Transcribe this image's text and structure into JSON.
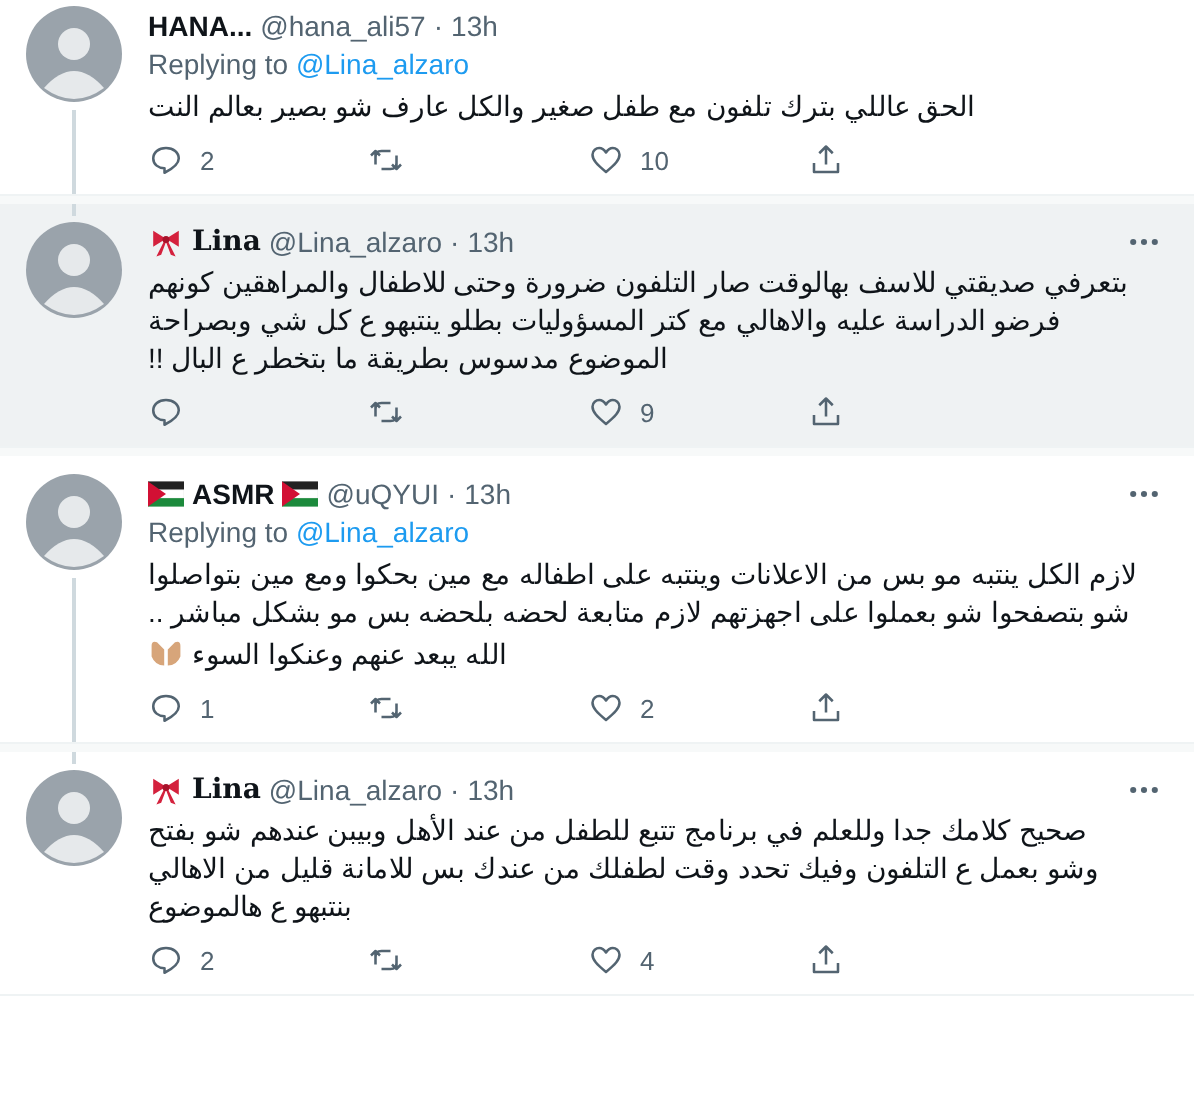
{
  "tweets": [
    {
      "name": "HANA...",
      "handle": "@hana_ali57",
      "separator": "·",
      "time": "13h",
      "show_more": false,
      "highlighted": false,
      "line_above": false,
      "line_below": true,
      "replying_label": "Replying to",
      "replying_to": "@Lina_alzaro",
      "paragraphs": [
        {
          "text": "الحق عاللي بترك تلفون مع طفل صغير والكل عارف شو بصير بعالم النت"
        }
      ],
      "replies": "2",
      "likes": "10"
    },
    {
      "name": "Lina",
      "name_serif": true,
      "ribbon_badge": true,
      "handle": "@Lina_alzaro",
      "separator": "·",
      "time": "13h",
      "show_more": true,
      "highlighted": true,
      "line_above": true,
      "line_below": false,
      "paragraphs": [
        {
          "text": "بتعرفي صديقتي للاسف بهالوقت صار التلفون ضرورة وحتى للاطفال والمراهقين كونهم فرضو الدراسة عليه والاهالي مع كتر المسؤوليات بطلو ينتبهو ع كل شي وبصراحة الموضوع مدسوس بطريقة ما بتخطر ع البال !!"
        }
      ],
      "likes": "9"
    },
    {
      "name": "ASMR",
      "flag_badges": true,
      "handle": "@uQYUI",
      "separator": "·",
      "time": "13h",
      "show_more": true,
      "highlighted": false,
      "line_above": false,
      "line_below": true,
      "replying_label": "Replying to",
      "replying_to": "@Lina_alzaro",
      "paragraphs": [
        {
          "text": "لازم الكل ينتبه مو بس من الاعلانات وينتبه على اطفاله مع مين بحكوا ومع مين بتواصلوا شو بتصفحوا شو بعملوا على اجهزتهم لازم متابعة لحضه بلحضه بس مو بشكل مباشر .."
        },
        {
          "text": "الله يبعد عنهم وعنكوا السوء",
          "hands_emoji": true
        }
      ],
      "replies": "1",
      "likes": "2"
    },
    {
      "name": "Lina",
      "name_serif": true,
      "ribbon_badge": true,
      "handle": "@Lina_alzaro",
      "separator": "·",
      "time": "13h",
      "show_more": true,
      "highlighted": false,
      "line_above": true,
      "line_below": false,
      "paragraphs": [
        {
          "text": "صحيح كلامك جدا وللعلم في برنامج تتبع للطفل من عند الأهل وبيبن عندهم شو بفتح وشو بعمل ع التلفون وفيك تحدد وقت لطفلك من عندك بس للامانة قليل من الاهالي بنتبهو ع هالموضوع"
        }
      ],
      "replies": "2",
      "likes": "4"
    }
  ]
}
